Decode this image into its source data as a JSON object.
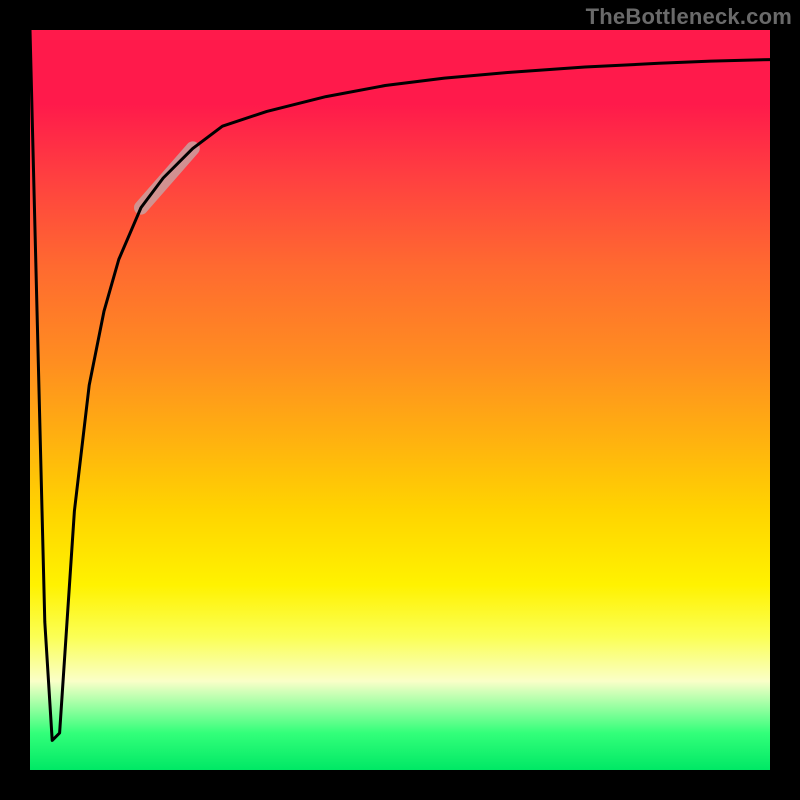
{
  "watermark": "TheBottleneck.com",
  "chart_data": {
    "type": "line",
    "xlabel": "",
    "ylabel": "",
    "xlim": [
      0,
      100
    ],
    "ylim": [
      0,
      100
    ],
    "grid": false,
    "series": [
      {
        "name": "curve",
        "x": [
          0,
          1,
          2,
          3,
          4,
          5,
          6,
          8,
          10,
          12,
          15,
          18,
          22,
          26,
          32,
          40,
          48,
          56,
          65,
          75,
          85,
          92,
          100
        ],
        "values": [
          100,
          60,
          20,
          4,
          5,
          20,
          35,
          52,
          62,
          69,
          76,
          80,
          84,
          87,
          89,
          91,
          92.5,
          93.5,
          94.3,
          95,
          95.5,
          95.8,
          96
        ]
      }
    ],
    "highlight_segment": {
      "x_start": 15,
      "x_end": 22
    },
    "colors": {
      "background_top": "#ff1a4b",
      "background_bottom": "#00e865",
      "curve": "#000000",
      "highlight": "#c9a0a0"
    }
  }
}
